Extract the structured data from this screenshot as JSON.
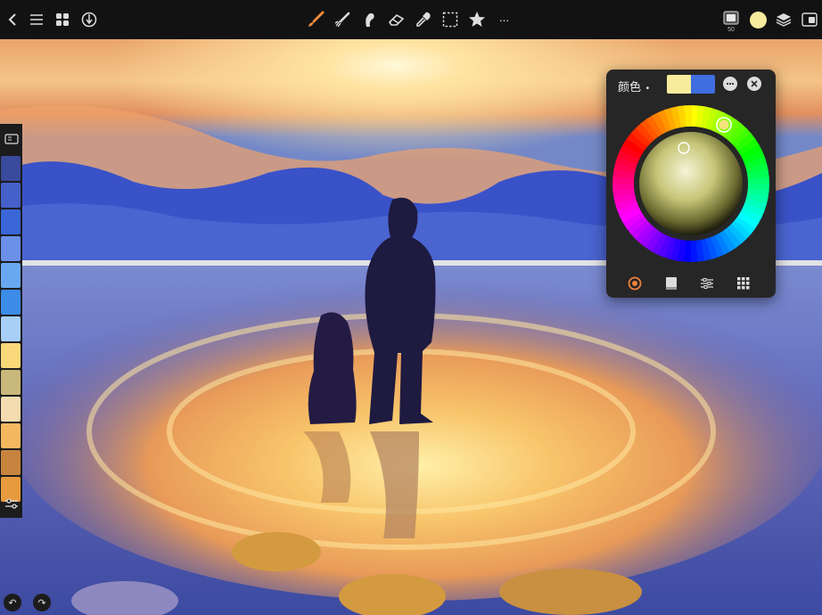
{
  "toolbar": {
    "left": [
      {
        "icon": "back-icon"
      },
      {
        "icon": "menu-icon"
      },
      {
        "icon": "gallery-icon"
      },
      {
        "icon": "actions-icon"
      }
    ],
    "tools": [
      {
        "icon": "brush-icon"
      },
      {
        "icon": "smudge-icon"
      },
      {
        "icon": "liquify-icon"
      },
      {
        "icon": "eraser-icon"
      },
      {
        "icon": "eyedropper-icon"
      },
      {
        "icon": "selection-icon"
      },
      {
        "icon": "favorites-icon"
      },
      {
        "icon": "more-icon",
        "glyph": "···"
      }
    ],
    "right": {
      "brush_size": "50",
      "current_color": "#f7eb9c"
    }
  },
  "color_panel": {
    "title": "颜色",
    "title_dot": "•",
    "primary_color": "#f7eb9c",
    "secondary_color": "#3e6ee0",
    "marker_color": "#f5e27d",
    "tabs": [
      {
        "icon": "disc-mode-icon",
        "active": true
      },
      {
        "icon": "classic-mode-icon",
        "active": false
      },
      {
        "icon": "value-mode-icon",
        "active": false
      },
      {
        "icon": "palette-mode-icon",
        "active": false
      }
    ],
    "active_color": "#f0823c"
  },
  "palette": {
    "colors": [
      "#3a4a9c",
      "#4560c8",
      "#3a66d8",
      "#6a90e8",
      "#68a8f0",
      "#3c8ce8",
      "#a8cff8",
      "#f8d878",
      "#c8b87a",
      "#f2dcb0",
      "#f4b860",
      "#c8843e",
      "#e89a3e"
    ]
  },
  "undo_glyph": "↶",
  "redo_glyph": "↷"
}
